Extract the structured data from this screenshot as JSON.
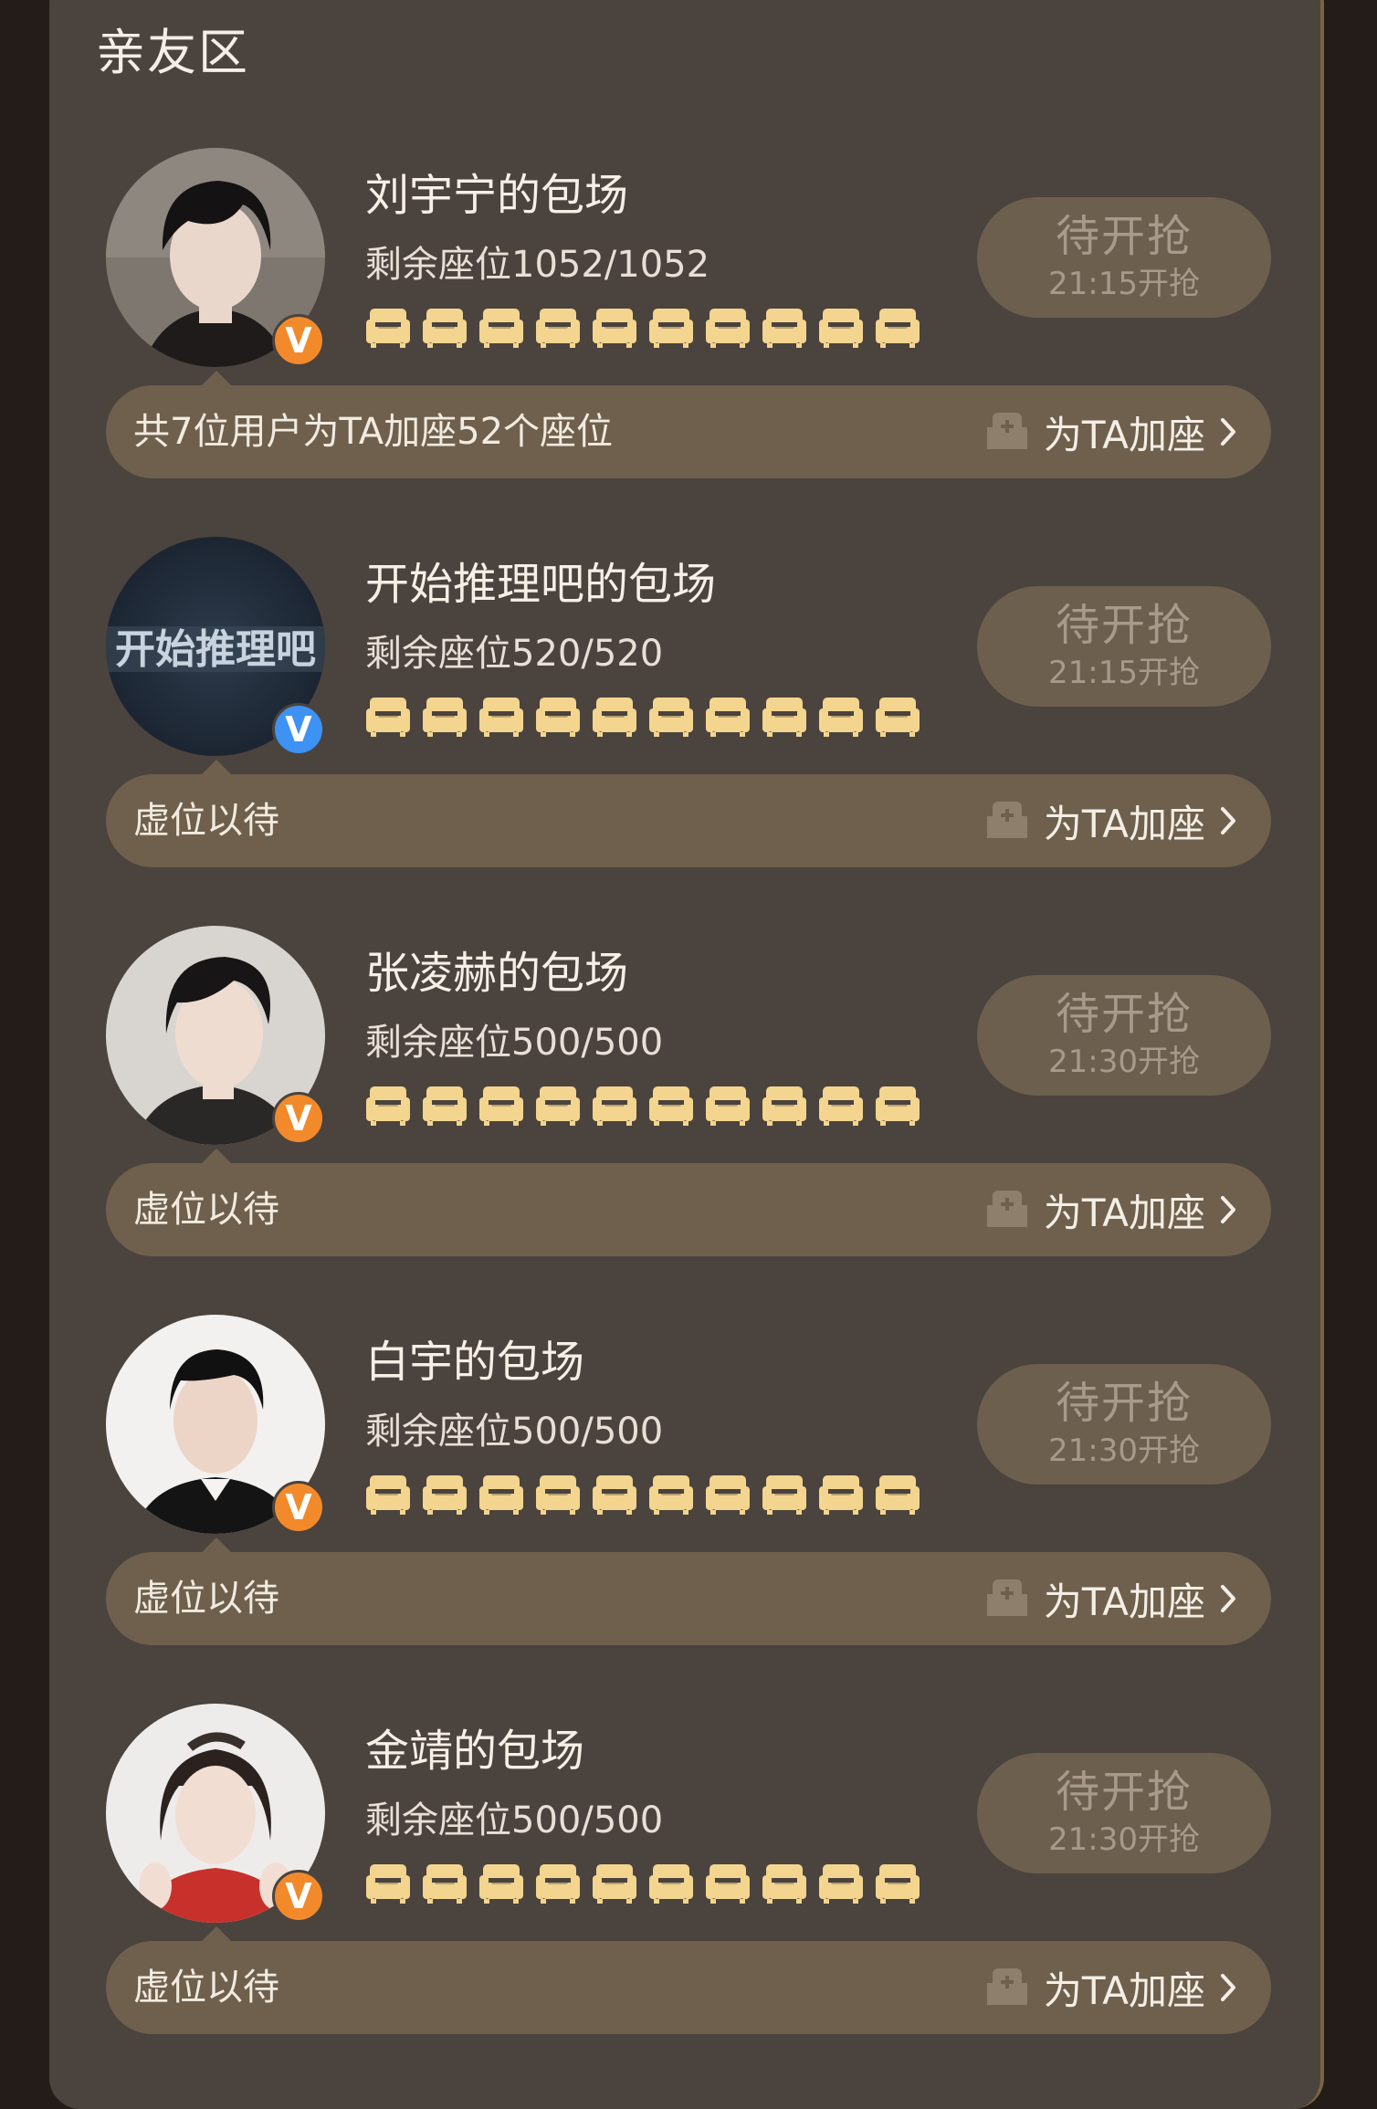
{
  "section": {
    "title": "亲友区"
  },
  "colors": {
    "seat_icon": "#f3d58f",
    "badge_orange": "#f28a2c",
    "badge_blue": "#3d92f3",
    "panel_bg": "#4b433d",
    "bar_bg": "#6e604c",
    "button_bg": "#6c5f4e"
  },
  "cards": [
    {
      "title": "刘宇宁的包场",
      "seats": "剩余座位1052/1052",
      "seat_icons": 10,
      "badge": {
        "icon": "v-verified-icon",
        "color": "#f28a2c",
        "glyph": "V"
      },
      "button": {
        "status": "待开抢",
        "time": "21:15开抢"
      },
      "support": {
        "text": "共7位用户为TA加座52个座位",
        "action": "为TA加座"
      }
    },
    {
      "title": "开始推理吧的包场",
      "seats": "剩余座位520/520",
      "seat_icons": 10,
      "avatar_logo": "开始推理吧",
      "badge": {
        "icon": "v-verified-icon",
        "color": "#3d92f3",
        "glyph": "V"
      },
      "button": {
        "status": "待开抢",
        "time": "21:15开抢"
      },
      "support": {
        "text": "虚位以待",
        "action": "为TA加座"
      }
    },
    {
      "title": "张凌赫的包场",
      "seats": "剩余座位500/500",
      "seat_icons": 10,
      "badge": {
        "icon": "v-verified-icon",
        "color": "#f28a2c",
        "glyph": "V"
      },
      "button": {
        "status": "待开抢",
        "time": "21:30开抢"
      },
      "support": {
        "text": "虚位以待",
        "action": "为TA加座"
      }
    },
    {
      "title": "白宇的包场",
      "seats": "剩余座位500/500",
      "seat_icons": 10,
      "badge": {
        "icon": "v-verified-icon",
        "color": "#f28a2c",
        "glyph": "V"
      },
      "button": {
        "status": "待开抢",
        "time": "21:30开抢"
      },
      "support": {
        "text": "虚位以待",
        "action": "为TA加座"
      }
    },
    {
      "title": "金靖的包场",
      "seats": "剩余座位500/500",
      "seat_icons": 10,
      "badge": {
        "icon": "v-verified-icon",
        "color": "#f28a2c",
        "glyph": "V"
      },
      "button": {
        "status": "待开抢",
        "time": "21:30开抢"
      },
      "support": {
        "text": "虚位以待",
        "action": "为TA加座"
      }
    }
  ]
}
